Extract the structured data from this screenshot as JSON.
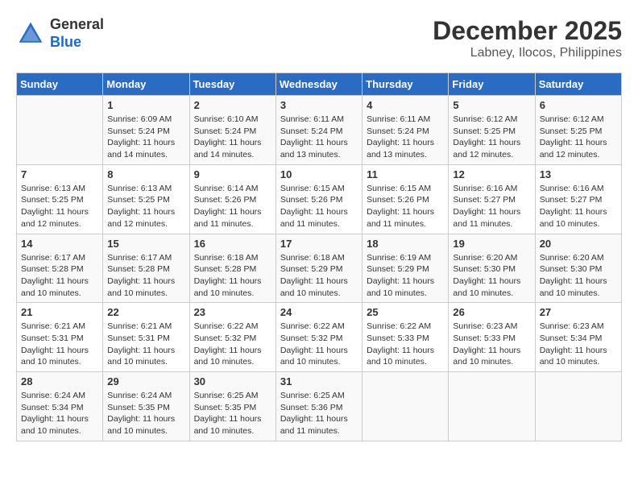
{
  "header": {
    "logo_line1": "General",
    "logo_line2": "Blue",
    "month_year": "December 2025",
    "location": "Labney, Ilocos, Philippines"
  },
  "days_of_week": [
    "Sunday",
    "Monday",
    "Tuesday",
    "Wednesday",
    "Thursday",
    "Friday",
    "Saturday"
  ],
  "weeks": [
    [
      {
        "day": "",
        "info": ""
      },
      {
        "day": "1",
        "info": "Sunrise: 6:09 AM\nSunset: 5:24 PM\nDaylight: 11 hours\nand 14 minutes."
      },
      {
        "day": "2",
        "info": "Sunrise: 6:10 AM\nSunset: 5:24 PM\nDaylight: 11 hours\nand 14 minutes."
      },
      {
        "day": "3",
        "info": "Sunrise: 6:11 AM\nSunset: 5:24 PM\nDaylight: 11 hours\nand 13 minutes."
      },
      {
        "day": "4",
        "info": "Sunrise: 6:11 AM\nSunset: 5:24 PM\nDaylight: 11 hours\nand 13 minutes."
      },
      {
        "day": "5",
        "info": "Sunrise: 6:12 AM\nSunset: 5:25 PM\nDaylight: 11 hours\nand 12 minutes."
      },
      {
        "day": "6",
        "info": "Sunrise: 6:12 AM\nSunset: 5:25 PM\nDaylight: 11 hours\nand 12 minutes."
      }
    ],
    [
      {
        "day": "7",
        "info": "Sunrise: 6:13 AM\nSunset: 5:25 PM\nDaylight: 11 hours\nand 12 minutes."
      },
      {
        "day": "8",
        "info": "Sunrise: 6:13 AM\nSunset: 5:25 PM\nDaylight: 11 hours\nand 12 minutes."
      },
      {
        "day": "9",
        "info": "Sunrise: 6:14 AM\nSunset: 5:26 PM\nDaylight: 11 hours\nand 11 minutes."
      },
      {
        "day": "10",
        "info": "Sunrise: 6:15 AM\nSunset: 5:26 PM\nDaylight: 11 hours\nand 11 minutes."
      },
      {
        "day": "11",
        "info": "Sunrise: 6:15 AM\nSunset: 5:26 PM\nDaylight: 11 hours\nand 11 minutes."
      },
      {
        "day": "12",
        "info": "Sunrise: 6:16 AM\nSunset: 5:27 PM\nDaylight: 11 hours\nand 11 minutes."
      },
      {
        "day": "13",
        "info": "Sunrise: 6:16 AM\nSunset: 5:27 PM\nDaylight: 11 hours\nand 10 minutes."
      }
    ],
    [
      {
        "day": "14",
        "info": "Sunrise: 6:17 AM\nSunset: 5:28 PM\nDaylight: 11 hours\nand 10 minutes."
      },
      {
        "day": "15",
        "info": "Sunrise: 6:17 AM\nSunset: 5:28 PM\nDaylight: 11 hours\nand 10 minutes."
      },
      {
        "day": "16",
        "info": "Sunrise: 6:18 AM\nSunset: 5:28 PM\nDaylight: 11 hours\nand 10 minutes."
      },
      {
        "day": "17",
        "info": "Sunrise: 6:18 AM\nSunset: 5:29 PM\nDaylight: 11 hours\nand 10 minutes."
      },
      {
        "day": "18",
        "info": "Sunrise: 6:19 AM\nSunset: 5:29 PM\nDaylight: 11 hours\nand 10 minutes."
      },
      {
        "day": "19",
        "info": "Sunrise: 6:20 AM\nSunset: 5:30 PM\nDaylight: 11 hours\nand 10 minutes."
      },
      {
        "day": "20",
        "info": "Sunrise: 6:20 AM\nSunset: 5:30 PM\nDaylight: 11 hours\nand 10 minutes."
      }
    ],
    [
      {
        "day": "21",
        "info": "Sunrise: 6:21 AM\nSunset: 5:31 PM\nDaylight: 11 hours\nand 10 minutes."
      },
      {
        "day": "22",
        "info": "Sunrise: 6:21 AM\nSunset: 5:31 PM\nDaylight: 11 hours\nand 10 minutes."
      },
      {
        "day": "23",
        "info": "Sunrise: 6:22 AM\nSunset: 5:32 PM\nDaylight: 11 hours\nand 10 minutes."
      },
      {
        "day": "24",
        "info": "Sunrise: 6:22 AM\nSunset: 5:32 PM\nDaylight: 11 hours\nand 10 minutes."
      },
      {
        "day": "25",
        "info": "Sunrise: 6:22 AM\nSunset: 5:33 PM\nDaylight: 11 hours\nand 10 minutes."
      },
      {
        "day": "26",
        "info": "Sunrise: 6:23 AM\nSunset: 5:33 PM\nDaylight: 11 hours\nand 10 minutes."
      },
      {
        "day": "27",
        "info": "Sunrise: 6:23 AM\nSunset: 5:34 PM\nDaylight: 11 hours\nand 10 minutes."
      }
    ],
    [
      {
        "day": "28",
        "info": "Sunrise: 6:24 AM\nSunset: 5:34 PM\nDaylight: 11 hours\nand 10 minutes."
      },
      {
        "day": "29",
        "info": "Sunrise: 6:24 AM\nSunset: 5:35 PM\nDaylight: 11 hours\nand 10 minutes."
      },
      {
        "day": "30",
        "info": "Sunrise: 6:25 AM\nSunset: 5:35 PM\nDaylight: 11 hours\nand 10 minutes."
      },
      {
        "day": "31",
        "info": "Sunrise: 6:25 AM\nSunset: 5:36 PM\nDaylight: 11 hours\nand 11 minutes."
      },
      {
        "day": "",
        "info": ""
      },
      {
        "day": "",
        "info": ""
      },
      {
        "day": "",
        "info": ""
      }
    ]
  ]
}
